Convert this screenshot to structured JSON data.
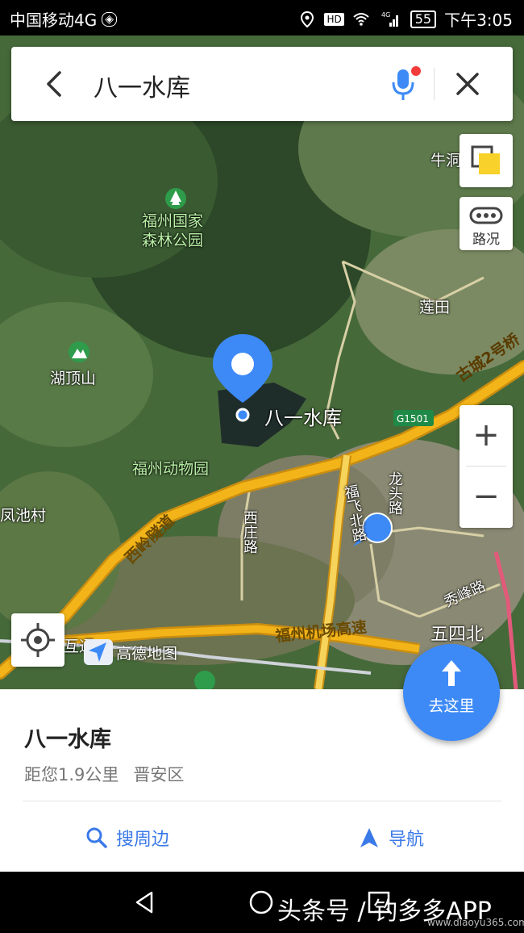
{
  "status_bar": {
    "carrier": "中国移动4G",
    "network": "4G",
    "battery": "55",
    "time": "下午3:05"
  },
  "search": {
    "query": "八一水库"
  },
  "controls": {
    "traffic_label": "路况",
    "zoom_in": "+",
    "zoom_out": "−",
    "go_label": "去这里"
  },
  "map": {
    "labels": {
      "park": "福州国家森林公园",
      "park_line1": "福州国家",
      "park_line2": "森林公园",
      "mountain": "湖顶山",
      "zoo": "福州动物园",
      "village_left": "凤池村",
      "village_top_right": "牛洞",
      "lianhua": "莲田",
      "reservoir": "八一水库",
      "wusibei": "五四北",
      "huling": "岭互通",
      "gaode": "高德地图"
    },
    "roads": {
      "gucheng": "古城2号桥",
      "g1501": "G1501",
      "xiling": "西岭隧道",
      "fuzhou_airport": "福州机场高速",
      "xizhuang": "西庄路",
      "fufei": "福飞北路",
      "longtou": "龙头路",
      "xiufeng": "秀峰路"
    },
    "icons": [
      "park-icon",
      "mountain-icon",
      "destination-pin-icon",
      "current-location-icon"
    ]
  },
  "place": {
    "name": "八一水库",
    "distance": "距您1.9公里",
    "district": "晋安区"
  },
  "actions": {
    "around": "搜周边",
    "navigate": "导航"
  },
  "watermark": {
    "text": "头条号 / 钓多多APP",
    "url": "www.diaoyu365.com"
  },
  "colors": {
    "accent": "#3d8af7",
    "action_text": "#3a79e8",
    "road": "#f2b418"
  }
}
